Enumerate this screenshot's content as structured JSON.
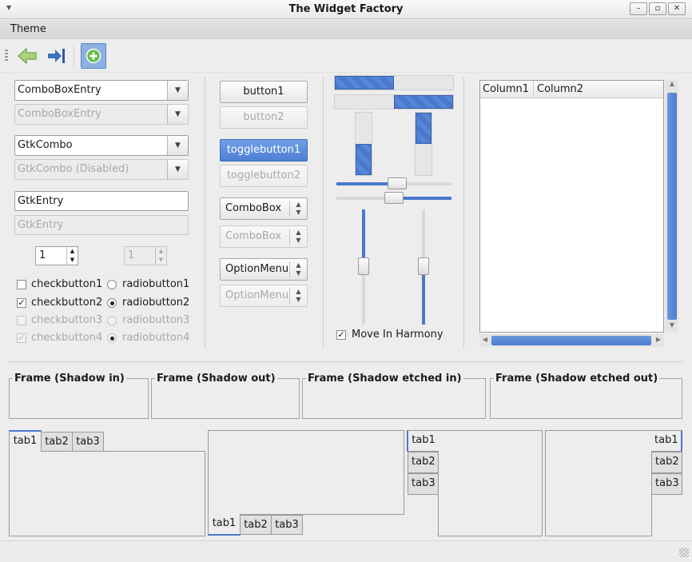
{
  "window": {
    "title": "The Widget Factory"
  },
  "menubar": {
    "theme": "Theme"
  },
  "toolbar": {
    "back": "back-arrow-icon",
    "forward": "goto-last-icon",
    "add": "add-icon"
  },
  "col1": {
    "combo_entry": "ComboBoxEntry",
    "combo_entry_dis": "ComboBoxEntry",
    "gtkcombo": "GtkCombo",
    "gtkcombo_dis": "GtkCombo (Disabled)",
    "entry": "GtkEntry",
    "entry_dis": "GtkEntry",
    "spin": "1",
    "spin_dis": "1",
    "checks": [
      "checkbutton1",
      "checkbutton2",
      "checkbutton3",
      "checkbutton4"
    ],
    "radios": [
      "radiobutton1",
      "radiobutton2",
      "radiobutton3",
      "radiobutton4"
    ]
  },
  "col2": {
    "button1": "button1",
    "button2": "button2",
    "toggle1": "togglebutton1",
    "toggle2": "togglebutton2",
    "combobox": "ComboBox",
    "combobox_dis": "ComboBox",
    "optionmenu": "OptionMenu",
    "optionmenu_dis": "OptionMenu"
  },
  "col3": {
    "harmony": "Move In Harmony",
    "progress_h1": 0.5,
    "progress_h2": 0.5,
    "progress_v1": 0.5,
    "progress_v2": 0.5,
    "hscale_1": 0.5,
    "hscale_2": 0.5,
    "vscale_1": 0.5,
    "vscale_2": 0.5
  },
  "tree": {
    "columns": [
      "Column1",
      "Column2"
    ]
  },
  "frames": [
    "Frame (Shadow in)",
    "Frame (Shadow out)",
    "Frame (Shadow etched in)",
    "Frame (Shadow etched out)"
  ],
  "notebooks": {
    "tabs": [
      "tab1",
      "tab2",
      "tab3"
    ]
  },
  "colors": {
    "accent": "#4a78cc",
    "window_bg": "#ededed"
  }
}
